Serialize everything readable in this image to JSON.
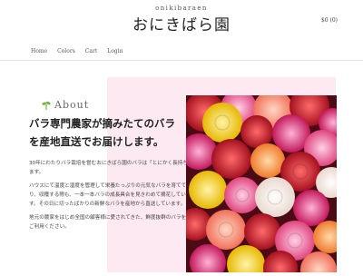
{
  "header": {
    "logo_romaji": "onikibaraen",
    "logo_kanji": "おにきばら園",
    "cart_count": "$0 (0)"
  },
  "nav": {
    "items": [
      "Home",
      "Colors",
      "Cart",
      "Login"
    ]
  },
  "about": {
    "label": "About",
    "headline": "バラ専門農家が摘みたてのバラを産地直送でお届けします。",
    "paragraphs": [
      "30年にわたりバラ栽培を営むおにきばら園のバラは「とにかく長持ち」します。",
      "ハウスにて温度と湿度を管理して栄養たっぷりの元気なバラを育てており、収穫する際も、一本一本バラの成長具合を見きわめて摘花しています。その日に切ったばかりの新鮮なバラを産地から直送しています。",
      "地元の農家をはじめ全国の顧客様に愛されてきた、鮮度抜群のバラをぜひご利用ください。"
    ]
  },
  "colors": {
    "panel_pink": "#fde9f1",
    "leaf_green": "#7bb241"
  }
}
